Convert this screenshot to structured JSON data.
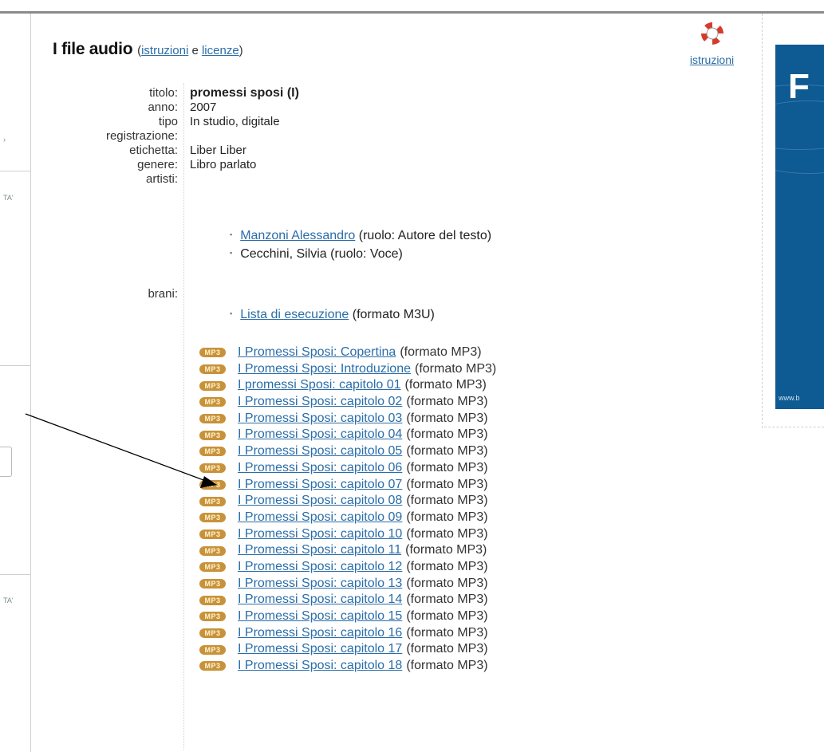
{
  "header": {
    "title": "I file audio",
    "open_paren": "(",
    "link_istruzioni": "istruzioni",
    "and_text": " e ",
    "link_licenze": "licenze",
    "close_paren": ")"
  },
  "help": {
    "icon": "lifebuoy-icon",
    "label": "istruzioni"
  },
  "banner": {
    "big_letter": "F",
    "url": "www.b"
  },
  "sidebar": {
    "glyph_top": "›",
    "label_1": "TA'",
    "label_2": "TA'"
  },
  "meta": {
    "titolo_label": "titolo:",
    "titolo": "promessi sposi (I)",
    "anno_label": "anno:",
    "anno": "2007",
    "tipo_label": "tipo",
    "tipo": "In studio, digitale",
    "registrazione_label": "registrazione:",
    "etichetta_label": "etichetta:",
    "etichetta": "Liber Liber",
    "genere_label": "genere:",
    "genere": "Libro parlato",
    "artisti_label": "artisti:",
    "brani_label": "brani:"
  },
  "artists": [
    {
      "name": "Manzoni Alessandro",
      "role": " (ruolo: Autore del testo)"
    },
    {
      "name": "Cecchini, Silvia",
      "role": " (ruolo: Voce)"
    }
  ],
  "playlist": {
    "label": "Lista di esecuzione",
    "format": " (formato M3U)"
  },
  "mp3_badge": "MP3",
  "format_mp3": "(formato MP3)",
  "tracks": [
    "I Promessi Sposi: Copertina",
    "I Promessi Sposi: Introduzione",
    "I promessi Sposi: capitolo 01",
    "I Promessi Sposi: capitolo 02",
    "I Promessi Sposi: capitolo 03",
    "I Promessi Sposi: capitolo 04",
    "I Promessi Sposi: capitolo 05",
    "I Promessi Sposi: capitolo 06",
    "I Promessi Sposi: capitolo 07",
    "I Promessi Sposi: capitolo 08",
    "I Promessi Sposi: capitolo 09",
    "I Promessi Sposi: capitolo 10",
    "I Promessi Sposi: capitolo 11",
    "I Promessi Sposi: capitolo 12",
    "I Promessi Sposi: capitolo 13",
    "I Promessi Sposi: capitolo 14",
    "I Promessi Sposi: capitolo 15",
    "I Promessi Sposi: capitolo 16",
    "I Promessi Sposi: capitolo 17",
    "I Promessi Sposi: capitolo 18"
  ],
  "colors": {
    "link": "#2a6da8",
    "badge": "#c8923a",
    "banner": "#0e5a93"
  }
}
